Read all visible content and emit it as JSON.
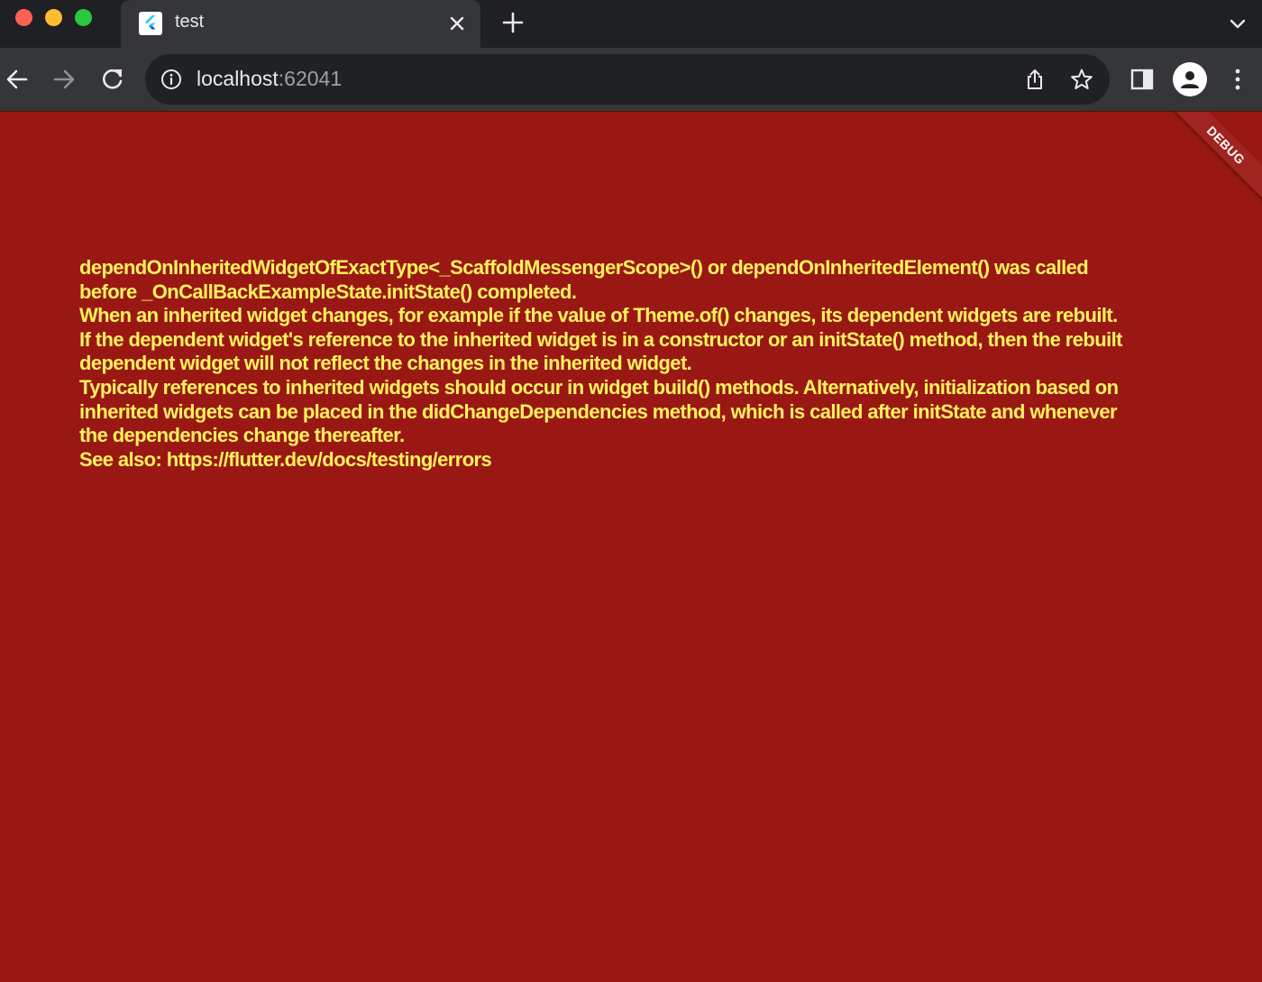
{
  "browser": {
    "tab": {
      "title": "test",
      "favicon": "flutter-logo-icon"
    },
    "url": {
      "host": "localhost",
      "port": ":62041"
    },
    "icons": {
      "back": "arrow-left-icon",
      "forward": "arrow-right-icon",
      "reload": "reload-icon",
      "info": "info-icon",
      "share": "share-icon",
      "star": "star-icon",
      "side_panel": "side-panel-icon",
      "profile": "person-icon",
      "menu": "three-dots-icon",
      "new_tab": "plus-icon",
      "tab_search": "chevron-down-icon",
      "close_tab": "close-icon"
    },
    "colors": {
      "tabstrip": "#1f2023",
      "toolbar": "#35363a",
      "omnibox": "#202124"
    }
  },
  "page": {
    "debug_banner": "DEBUG",
    "error_lines": [
      "dependOnInheritedWidgetOfExactType<_ScaffoldMessengerScope>() or dependOnInheritedElement() was called",
      "before _OnCallBackExampleState.initState() completed.",
      "When an inherited widget changes, for example if the value of Theme.of() changes, its dependent widgets are rebuilt.",
      "If the dependent widget's reference to the inherited widget is in a constructor or an initState() method, then the rebuilt",
      "dependent widget will not reflect the changes in the inherited widget.",
      "Typically references to inherited widgets should occur in widget build() methods. Alternatively, initialization based on",
      "inherited widgets can be placed in the didChangeDependencies method, which is called after initState and whenever",
      "the dependencies change thereafter.",
      "See also: https://flutter.dev/docs/testing/errors"
    ],
    "colors": {
      "background": "#9a1813",
      "error_text": "#fff25c",
      "banner": "#a0241f"
    }
  }
}
